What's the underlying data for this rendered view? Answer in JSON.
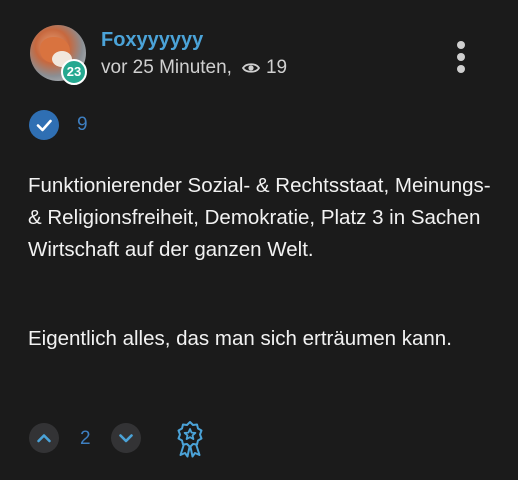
{
  "author": {
    "name": "Foxyyyyyy",
    "level": "23",
    "avatar_icon": "fox-avatar"
  },
  "meta": {
    "time": "vor 25 Minuten,",
    "views": "19",
    "views_icon": "eye-icon"
  },
  "helpful": {
    "count": "9",
    "icon": "check-icon"
  },
  "body": {
    "paragraph_1": "Funktionierender Sozial- & Rechtsstaat, Meinungs- & Religionsfreiheit, Demokratie, Platz 3 in Sachen Wirtschaft auf der ganzen Welt.",
    "paragraph_2": "Eigentlich alles, das man sich erträumen kann."
  },
  "votes": {
    "count": "2",
    "up_icon": "chevron-up-icon",
    "down_icon": "chevron-down-icon"
  },
  "award": {
    "icon": "award-medal-icon"
  },
  "colors": {
    "background": "#1b1b1b",
    "accent_blue": "#4ba3d8",
    "level_badge": "#25a890",
    "check_badge": "#2f6fb3"
  }
}
